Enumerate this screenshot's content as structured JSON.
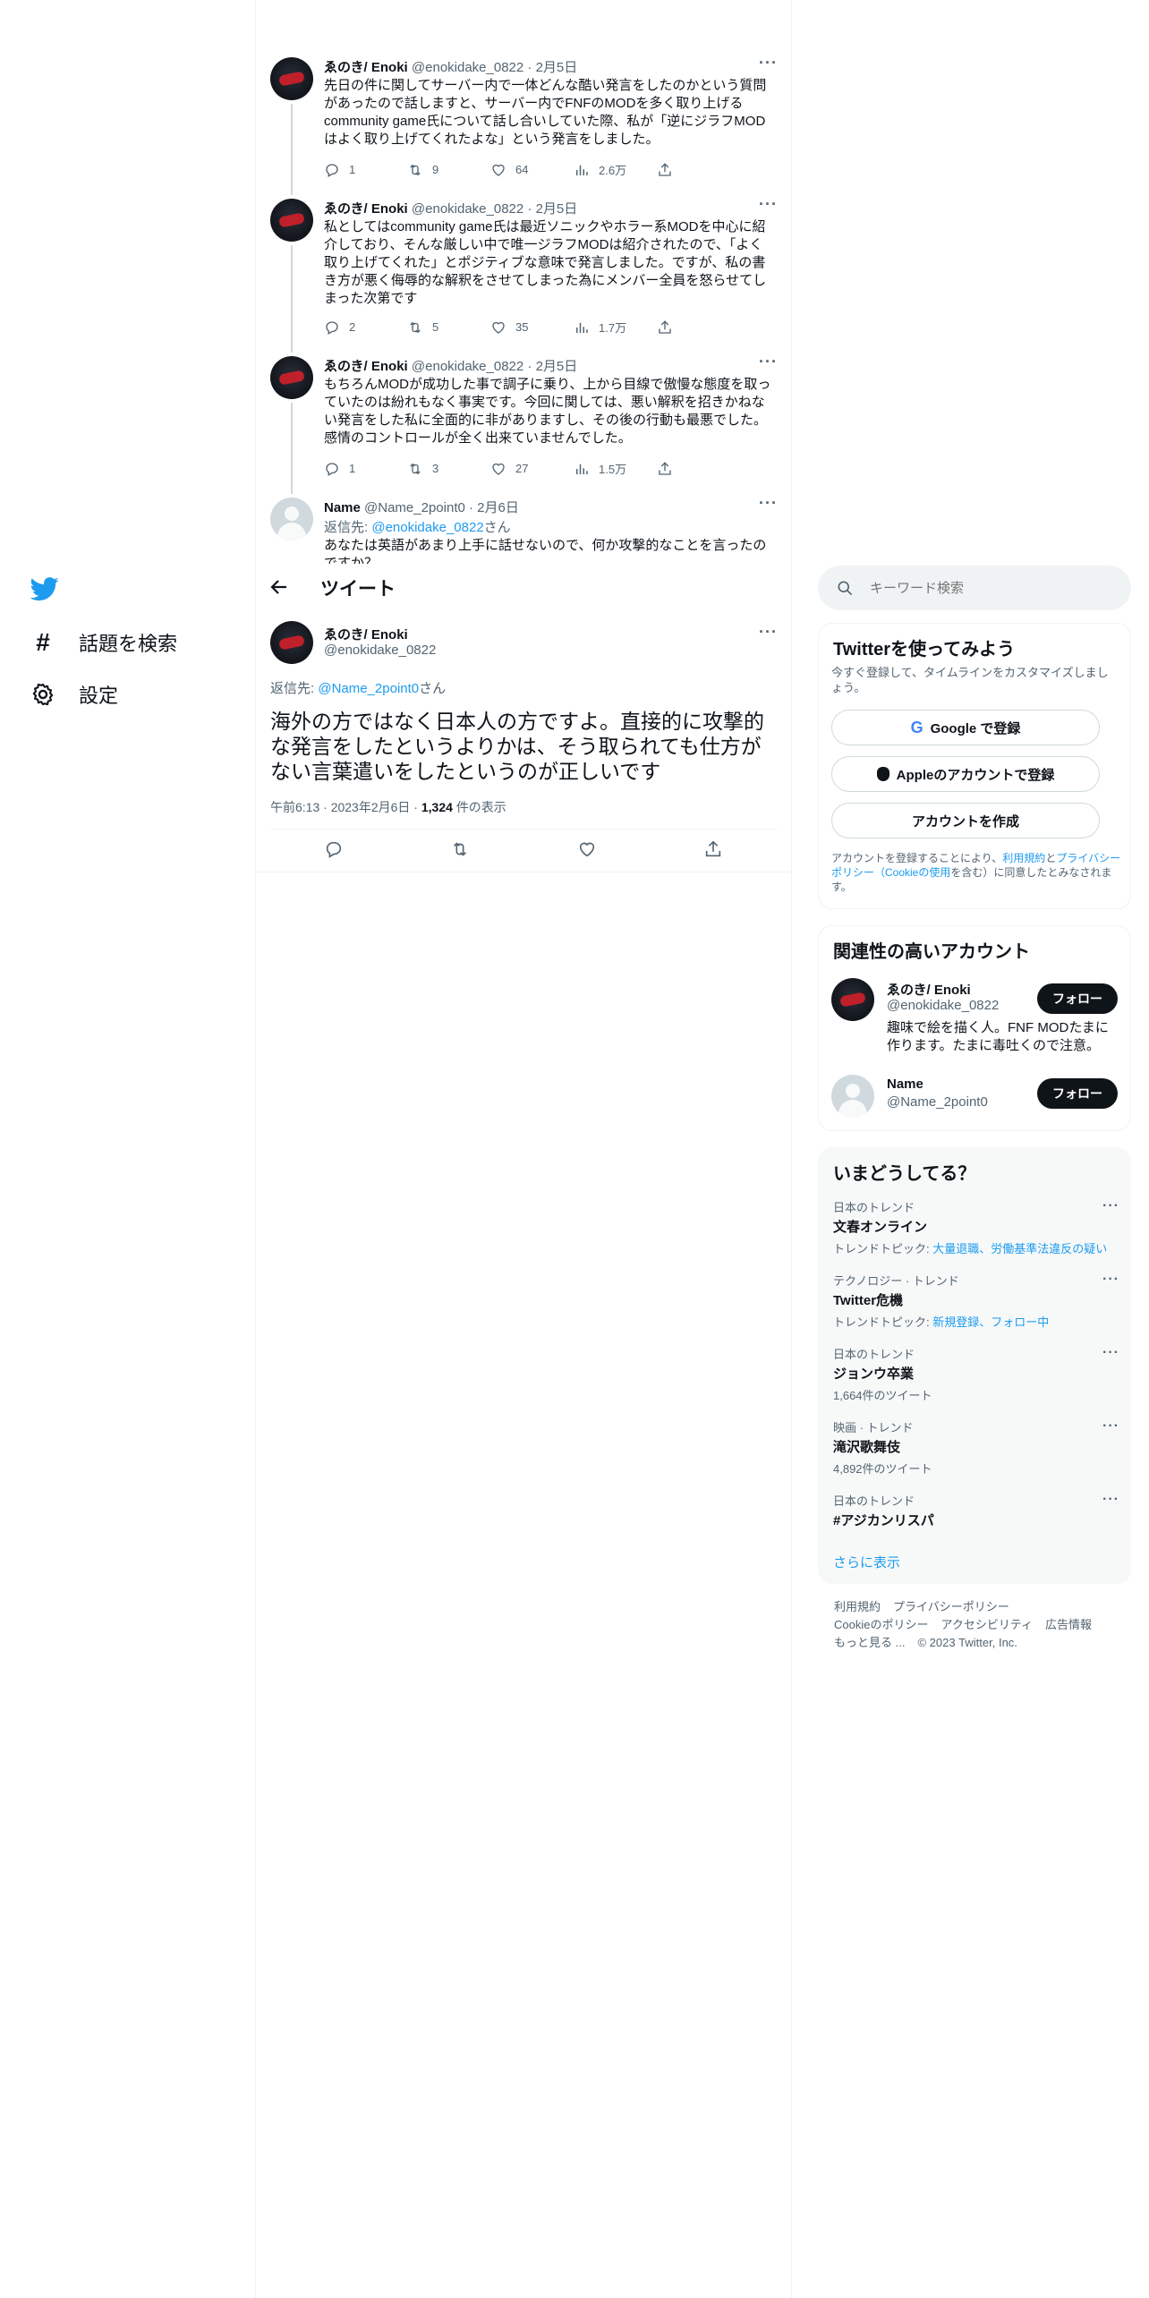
{
  "nav": {
    "explore_label": "話題を検索",
    "settings_label": "設定"
  },
  "tweets": [
    {
      "name": "ゑのき/ Enoki",
      "handle": "@enokidake_0822",
      "date": "2月5日",
      "text": "先日の件に関してサーバー内で一体どんな酷い発言をしたのかという質問があったので話しますと、サーバー内でFNFのMODを多く取り上げるcommunity game氏について話し合いしていた際、私が「逆にジラフMODはよく取り上げてくれたよな」という発言をしました。",
      "replies": "1",
      "retweets": "9",
      "likes": "64",
      "views": "2.6万"
    },
    {
      "name": "ゑのき/ Enoki",
      "handle": "@enokidake_0822",
      "date": "2月5日",
      "text": "私としてはcommunity game氏は最近ソニックやホラー系MODを中心に紹介しており、そんな厳しい中で唯一ジラフMODは紹介されたので、「よく取り上げてくれた」とポジティブな意味で発言しました。ですが、私の書き方が悪く侮辱的な解釈をさせてしまった為にメンバー全員を怒らせてしまった次第です",
      "replies": "2",
      "retweets": "5",
      "likes": "35",
      "views": "1.7万"
    },
    {
      "name": "ゑのき/ Enoki",
      "handle": "@enokidake_0822",
      "date": "2月5日",
      "text": "もちろんMODが成功した事で調子に乗り、上から目線で傲慢な態度を取っていたのは紛れもなく事実です。今回に関しては、悪い解釈を招きかねない発言をした私に全面的に非がありますし、その後の行動も最悪でした。感情のコントロールが全く出来ていませんでした。",
      "replies": "1",
      "retweets": "3",
      "likes": "27",
      "views": "1.5万"
    },
    {
      "name": "Name",
      "handle": "@Name_2point0",
      "date": "2月6日",
      "reply_prefix": "返信先: ",
      "reply_to": "@enokidake_0822",
      "reply_suffix": "さん",
      "text": "あなたは英語があまり上手に話せないので、何か攻撃的なことを言ったのですか？"
    }
  ],
  "header": {
    "title": "ツイート"
  },
  "main_tweet": {
    "name": "ゑのき/ Enoki",
    "handle": "@enokidake_0822",
    "reply_prefix": "返信先: ",
    "reply_to": "@Name_2point0",
    "reply_suffix": "さん",
    "text": "海外の方ではなく日本人の方ですよ。直接的に攻撃的な発言をしたというよりかは、そう取られても仕方がない言葉遣いをしたというのが正しいです",
    "time": "午前6:13",
    "date": "2023年2月6日",
    "views_count": "1,324",
    "views_label": "件の表示"
  },
  "search": {
    "placeholder": "キーワード検索"
  },
  "signup": {
    "title": "Twitterを使ってみよう",
    "desc": "今すぐ登録して、タイムラインをカスタマイズしましょう。",
    "google": "Google で登録",
    "apple": "Appleのアカウントで登録",
    "create": "アカウントを作成",
    "terms_1": "アカウントを登録することにより、",
    "terms_link1": "利用規約",
    "terms_2": "と",
    "terms_link2": "プライバシーポリシー（Cookieの使用",
    "terms_3": "を含む）に同意したとみなされます。"
  },
  "relevant": {
    "title": "関連性の高いアカウント",
    "accounts": [
      {
        "name": "ゑのき/ Enoki",
        "handle": "@enokidake_0822",
        "bio": "趣味で絵を描く人。FNF MODたまに作ります。たまに毒吐くので注意。",
        "follow": "フォロー"
      },
      {
        "name": "Name",
        "handle": "@Name_2point0",
        "bio": "",
        "follow": "フォロー"
      }
    ]
  },
  "trends": {
    "title": "いまどうしてる？",
    "items": [
      {
        "meta": "日本のトレンド",
        "name": "文春オンライン",
        "sub_prefix": "トレンドトピック: ",
        "sub_links": "大量退職、労働基準法違反の疑い"
      },
      {
        "meta": "テクノロジー · トレンド",
        "name": "Twitter危機",
        "sub_prefix": "トレンドトピック: ",
        "sub_links": "新規登録、フォロー中"
      },
      {
        "meta": "日本のトレンド",
        "name": "ジョンウ卒業",
        "sub_plain": "1,664件のツイート"
      },
      {
        "meta": "映画 · トレンド",
        "name": "滝沢歌舞伎",
        "sub_plain": "4,892件のツイート"
      },
      {
        "meta": "日本のトレンド",
        "name": "#アジカンリスパ"
      }
    ],
    "show_more": "さらに表示"
  },
  "footer": {
    "terms": "利用規約",
    "privacy": "プライバシーポリシー",
    "cookie": "Cookieのポリシー",
    "accessibility": "アクセシビリティ",
    "ads": "広告情報",
    "more": "もっと見る ...",
    "copyright": "© 2023 Twitter, Inc."
  },
  "colors": {
    "accent": "#1d9bf0",
    "text": "#0f1419",
    "secondary": "#536471"
  }
}
